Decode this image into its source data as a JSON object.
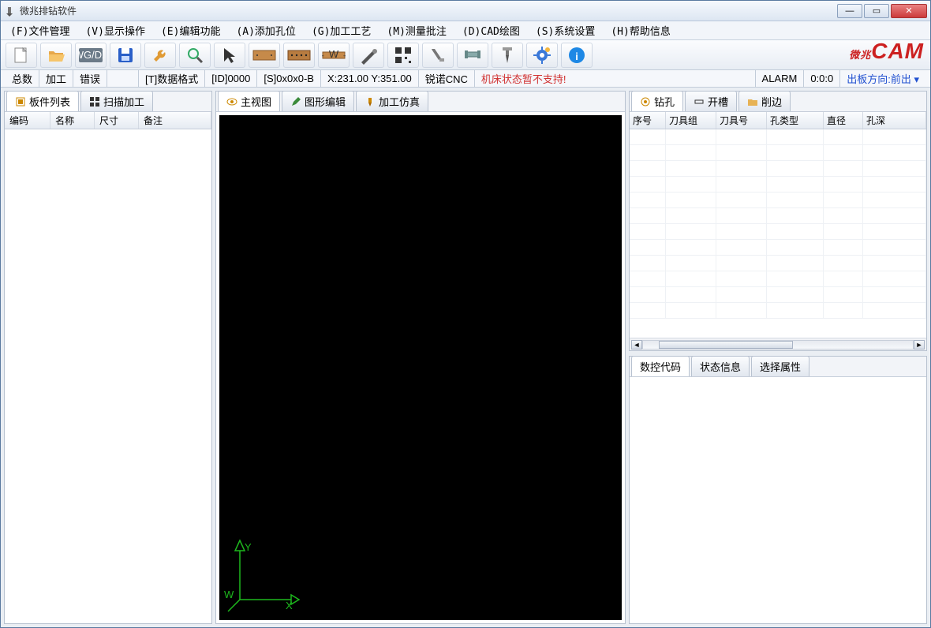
{
  "window": {
    "title": "微兆排钻软件"
  },
  "menu": [
    "(F)文件管理",
    "(V)显示操作",
    "(E)编辑功能",
    "(A)添加孔位",
    "(G)加工工艺",
    "(M)测量批注",
    "(D)CAD绘图",
    "(S)系统设置",
    "(H)帮助信息"
  ],
  "brand": "微兆CAM",
  "toolbar_icons": [
    "new",
    "open",
    "dwgdxf",
    "save",
    "tool",
    "zoom",
    "cursor",
    "board1",
    "board2",
    "measure",
    "probe",
    "qrcode",
    "caliper",
    "clamp",
    "drill",
    "gear",
    "info"
  ],
  "status": {
    "total_label": "总数",
    "work_label": "加工",
    "error_label": "错误",
    "tformat": "[T]数据格式",
    "id": "[ID]0000",
    "s": "[S]0x0x0-B",
    "coord": "X:231.00 Y:351.00",
    "cnc": "锐诺CNC",
    "machine": "机床状态暂不支持!",
    "alarm": "ALARM",
    "time": "0:0:0",
    "outdir": "出板方向:前出 ▾"
  },
  "left_panel": {
    "tabs": [
      "板件列表",
      "扫描加工"
    ],
    "columns": [
      "编码",
      "名称",
      "尺寸",
      "备注"
    ]
  },
  "center_panel": {
    "tabs": [
      "主视图",
      "图形编辑",
      "加工仿真"
    ],
    "axis": {
      "x": "X",
      "y": "Y",
      "w": "W"
    }
  },
  "right_top": {
    "tabs": [
      "钻孔",
      "开槽",
      "削边"
    ],
    "columns": [
      "序号",
      "刀具组",
      "刀具号",
      "孔类型",
      "直径",
      "孔深"
    ]
  },
  "right_bottom": {
    "tabs": [
      "数控代码",
      "状态信息",
      "选择属性"
    ]
  },
  "colors": {
    "red": "#d03030",
    "blue": "#2050d0"
  }
}
